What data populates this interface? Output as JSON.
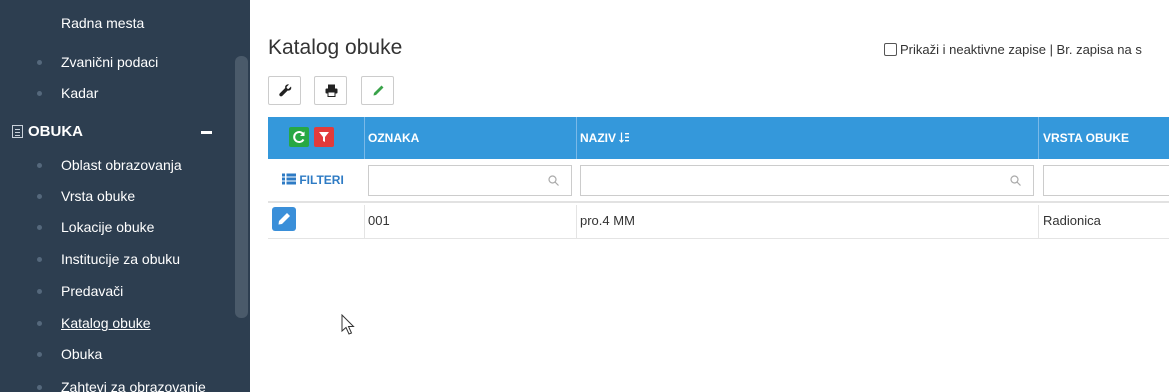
{
  "sidebar": {
    "items_top": [
      {
        "label": "Radna mesta"
      },
      {
        "label": "Zvanični podaci"
      },
      {
        "label": "Kadar"
      }
    ],
    "section": {
      "label": "OBUKA",
      "icon": "list-icon"
    },
    "items": [
      {
        "label": "Oblast obrazovanja"
      },
      {
        "label": "Vrsta obuke"
      },
      {
        "label": "Lokacije obuke"
      },
      {
        "label": "Institucije za obuku"
      },
      {
        "label": "Predavači"
      },
      {
        "label": "Katalog obuke",
        "active": true
      },
      {
        "label": "Obuka"
      },
      {
        "label": "Zahtevi za obrazovanje"
      }
    ]
  },
  "page": {
    "title": "Katalog obuke",
    "inactive_label": "Prikaži i neaktivne zapise | Br. zapisa na s"
  },
  "toolbar": {
    "buttons": [
      "wrench-icon",
      "print-icon",
      "pencil-icon"
    ]
  },
  "grid": {
    "columns": [
      {
        "label": "OZNAKA"
      },
      {
        "label": "NAZIV"
      },
      {
        "label": "VRSTA OBUKE"
      }
    ],
    "filter_label": "FILTERI",
    "rows": [
      {
        "oznaka": "001",
        "naziv": "pro.4 MM",
        "vrsta_obuke": "Radionica"
      }
    ]
  },
  "colors": {
    "sidebar_bg": "#2d3e50",
    "header_bg": "#3498db",
    "refresh_btn": "#27a844",
    "filter_btn": "#e23b3b",
    "edit_btn": "#3a8fd9"
  }
}
